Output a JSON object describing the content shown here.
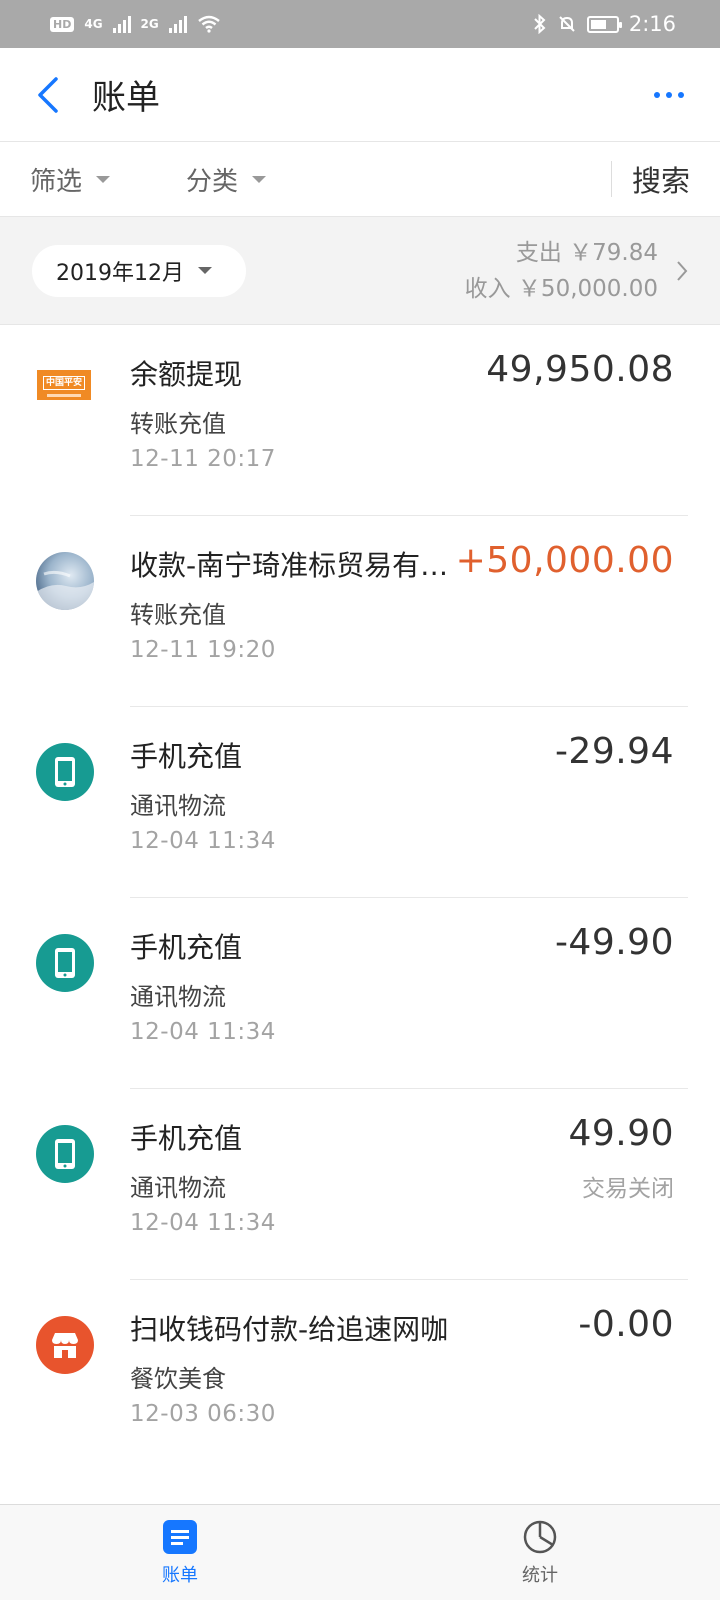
{
  "status_bar": {
    "time": "2:16",
    "network_1": "4G",
    "network_2": "2G"
  },
  "nav": {
    "title": "账单"
  },
  "filter": {
    "filter_label": "筛选",
    "category_label": "分类",
    "search_label": "搜索"
  },
  "month": {
    "label": "2019年12月",
    "expense": "支出 ￥79.84",
    "income": "收入 ￥50,000.00"
  },
  "transactions": [
    {
      "icon": "bank-logo",
      "title": "余额提现",
      "category": "转账充值",
      "time": "12-11  20:17",
      "amount": "49,950.08",
      "status": ""
    },
    {
      "icon": "avatar",
      "title": "收款-南宁琦准标贸易有…",
      "category": "转账充值",
      "time": "12-11  19:20",
      "amount": "+50,000.00",
      "status": ""
    },
    {
      "icon": "phone-icon",
      "title": "手机充值",
      "category": "通讯物流",
      "time": "12-04  11:34",
      "amount": "-29.94",
      "status": ""
    },
    {
      "icon": "phone-icon",
      "title": "手机充值",
      "category": "通讯物流",
      "time": "12-04  11:34",
      "amount": "-49.90",
      "status": ""
    },
    {
      "icon": "phone-icon",
      "title": "手机充值",
      "category": "通讯物流",
      "time": "12-04  11:34",
      "amount": "49.90",
      "status": "交易关闭"
    },
    {
      "icon": "store-icon",
      "title": "扫收钱码付款-给追速网咖",
      "category": "餐饮美食",
      "time": "12-03  06:30",
      "amount": "-0.00",
      "status": ""
    }
  ],
  "tabs": {
    "bill": "账单",
    "stats": "统计"
  },
  "colors": {
    "accent": "#1677ff",
    "income": "#e0602e",
    "teal": "#179b92",
    "orange": "#e8542d"
  }
}
